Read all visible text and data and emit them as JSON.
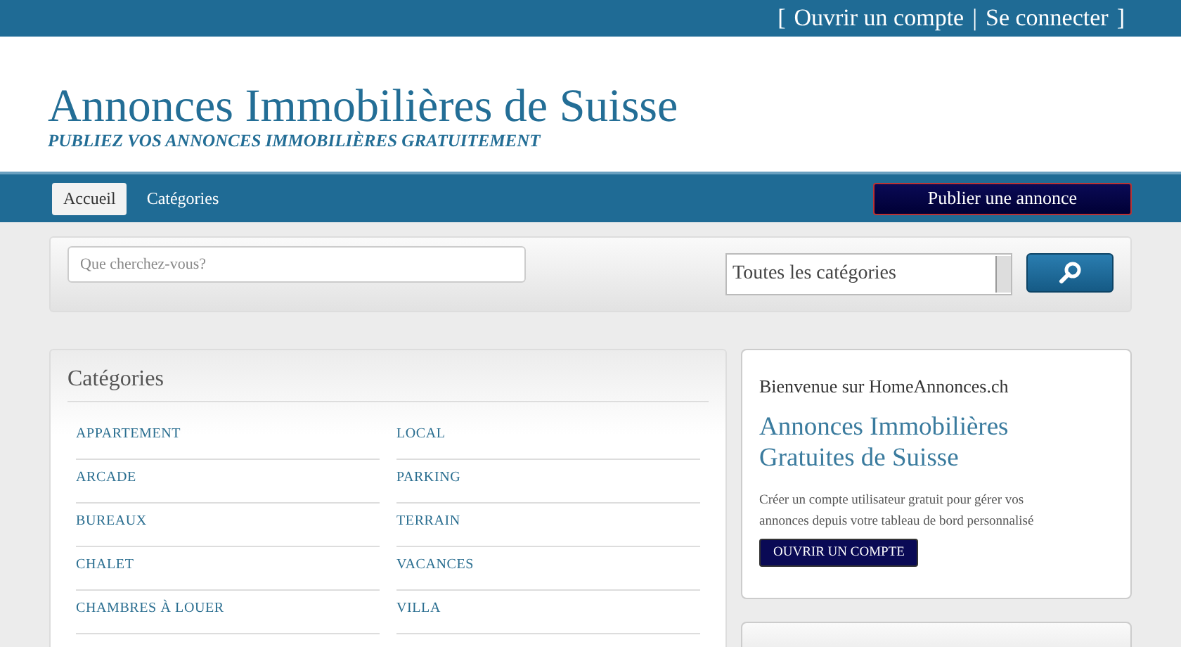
{
  "top_bar": {
    "open": "[",
    "links": [
      "Ouvrir un compte",
      "Se connecter"
    ],
    "separator": "|",
    "close": "]"
  },
  "header": {
    "title": "Annonces Immobilières de Suisse",
    "tagline": "PUBLIEZ VOS ANNONCES IMMOBILIÈRES GRATUITEMENT"
  },
  "nav": {
    "tabs": [
      {
        "label": "Accueil",
        "selected": true
      },
      {
        "label": "Catégories",
        "selected": false
      }
    ],
    "publish_button": "Publier une annonce"
  },
  "search": {
    "placeholder": "Que cherchez-vous?",
    "category": "Toutes les catégories"
  },
  "categories": {
    "heading": "Catégories",
    "items": [
      "APPARTEMENT",
      "LOCAL",
      "ARCADE",
      "PARKING",
      "BUREAUX",
      "TERRAIN",
      "CHALET",
      "VACANCES",
      "CHAMBRES À LOUER",
      "VILLA"
    ]
  },
  "welcome": {
    "greeting": "Bienvenue sur HomeAnnonces.ch",
    "title": "Annonces Immobilières Gratuites de Suisse",
    "text": "Créer un compte utilisateur gratuit pour gérer vos annonces depuis votre tableau de bord personnalisé",
    "button": "OUVRIR UN COMPTE"
  }
}
